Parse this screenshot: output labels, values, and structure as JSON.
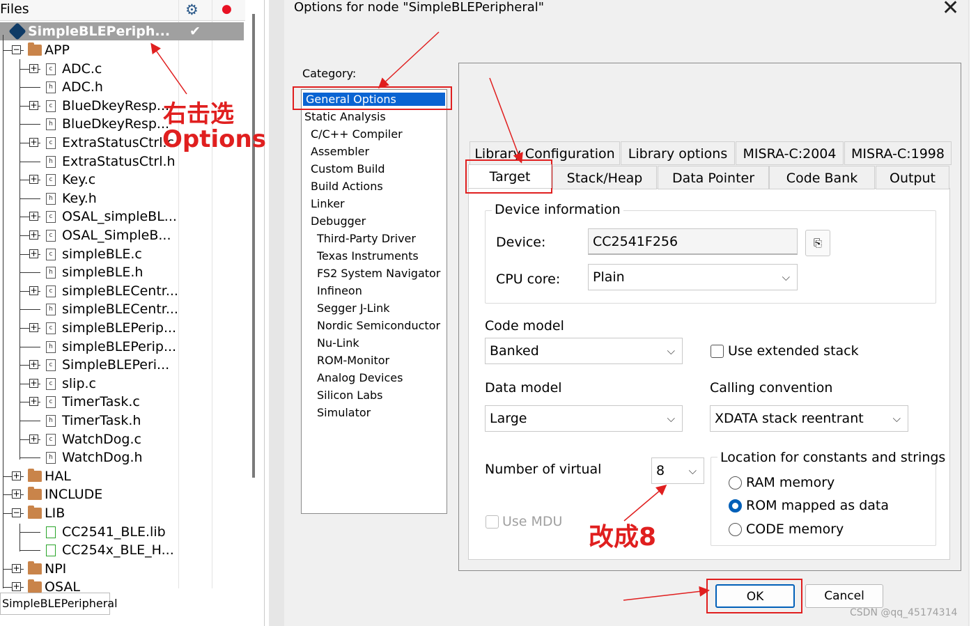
{
  "workspace": {
    "files_label": "Files",
    "project_name": "SimpleBLEPeriph...",
    "project_check": "✔",
    "bottom_tab": "SimpleBLEPeripheral",
    "tree": [
      {
        "label": "APP",
        "type": "folder",
        "level": 1,
        "pm": "−"
      },
      {
        "label": "ADC.c",
        "type": "c",
        "level": 2,
        "pm": "+"
      },
      {
        "label": "ADC.h",
        "type": "h",
        "level": 2,
        "pm": ""
      },
      {
        "label": "BlueDkeyResp...",
        "type": "c",
        "level": 2,
        "pm": "+"
      },
      {
        "label": "BlueDkeyResp...",
        "type": "h",
        "level": 2,
        "pm": ""
      },
      {
        "label": "ExtraStatusCtrl.c",
        "type": "c",
        "level": 2,
        "pm": "+"
      },
      {
        "label": "ExtraStatusCtrl.h",
        "type": "h",
        "level": 2,
        "pm": ""
      },
      {
        "label": "Key.c",
        "type": "c",
        "level": 2,
        "pm": "+"
      },
      {
        "label": "Key.h",
        "type": "h",
        "level": 2,
        "pm": ""
      },
      {
        "label": "OSAL_simpleBL...",
        "type": "c",
        "level": 2,
        "pm": "+"
      },
      {
        "label": "OSAL_SimpleB...",
        "type": "c",
        "level": 2,
        "pm": "+"
      },
      {
        "label": "simpleBLE.c",
        "type": "c",
        "level": 2,
        "pm": "+"
      },
      {
        "label": "simpleBLE.h",
        "type": "h",
        "level": 2,
        "pm": ""
      },
      {
        "label": "simpleBLECentr...",
        "type": "c",
        "level": 2,
        "pm": "+"
      },
      {
        "label": "simpleBLECentr...",
        "type": "h",
        "level": 2,
        "pm": ""
      },
      {
        "label": "simpleBLEPerip...",
        "type": "c",
        "level": 2,
        "pm": "+"
      },
      {
        "label": "simpleBLEPerip...",
        "type": "h",
        "level": 2,
        "pm": ""
      },
      {
        "label": "SimpleBLEPeri...",
        "type": "c",
        "level": 2,
        "pm": "+"
      },
      {
        "label": "slip.c",
        "type": "c",
        "level": 2,
        "pm": "+"
      },
      {
        "label": "TimerTask.c",
        "type": "c",
        "level": 2,
        "pm": "+"
      },
      {
        "label": "TimerTask.h",
        "type": "h",
        "level": 2,
        "pm": ""
      },
      {
        "label": "WatchDog.c",
        "type": "c",
        "level": 2,
        "pm": "+"
      },
      {
        "label": "WatchDog.h",
        "type": "h",
        "level": 2,
        "pm": ""
      },
      {
        "label": "HAL",
        "type": "folder",
        "level": 1,
        "pm": "+"
      },
      {
        "label": "INCLUDE",
        "type": "folder",
        "level": 1,
        "pm": "+"
      },
      {
        "label": "LIB",
        "type": "folder",
        "level": 1,
        "pm": "−"
      },
      {
        "label": "CC2541_BLE.lib",
        "type": "lib",
        "level": 2,
        "pm": ""
      },
      {
        "label": "CC254x_BLE_H...",
        "type": "lib",
        "level": 2,
        "pm": ""
      },
      {
        "label": "NPI",
        "type": "folder",
        "level": 1,
        "pm": "+"
      },
      {
        "label": "OSAL",
        "type": "folder",
        "level": 1,
        "pm": "+"
      }
    ]
  },
  "dialog": {
    "title": "Options for node \"SimpleBLEPeripheral\"",
    "close_glyph": "✕",
    "category_label": "Category:",
    "categories": [
      {
        "label": "General Options",
        "indent": 0,
        "selected": true
      },
      {
        "label": "Static Analysis",
        "indent": 0
      },
      {
        "label": "C/C++ Compiler",
        "indent": 1
      },
      {
        "label": "Assembler",
        "indent": 1
      },
      {
        "label": "Custom Build",
        "indent": 1
      },
      {
        "label": "Build Actions",
        "indent": 1
      },
      {
        "label": "Linker",
        "indent": 1
      },
      {
        "label": "Debugger",
        "indent": 1
      },
      {
        "label": "Third-Party Driver",
        "indent": 2
      },
      {
        "label": "Texas Instruments",
        "indent": 2
      },
      {
        "label": "FS2 System Navigator",
        "indent": 2
      },
      {
        "label": "Infineon",
        "indent": 2
      },
      {
        "label": "Segger J-Link",
        "indent": 2
      },
      {
        "label": "Nordic Semiconductor",
        "indent": 2
      },
      {
        "label": "Nu-Link",
        "indent": 2
      },
      {
        "label": "ROM-Monitor",
        "indent": 2
      },
      {
        "label": "Analog Devices",
        "indent": 2
      },
      {
        "label": "Silicon Labs",
        "indent": 2
      },
      {
        "label": "Simulator",
        "indent": 2
      }
    ],
    "tabs_row1": [
      "Library Configuration",
      "Library options",
      "MISRA-C:2004",
      "MISRA-C:1998"
    ],
    "tabs_row2": [
      "Target",
      "Stack/Heap",
      "Data Pointer",
      "Code Bank",
      "Output"
    ],
    "active_tab": "Target",
    "device_info": {
      "group_title": "Device information",
      "device_label": "Device:",
      "device_value": "CC2541F256",
      "cpu_label": "CPU core:",
      "cpu_value": "Plain"
    },
    "code_model": {
      "label": "Code model",
      "value": "Banked"
    },
    "use_extended_stack": {
      "label": "Use extended stack",
      "checked": false
    },
    "data_model": {
      "label": "Data model",
      "value": "Large"
    },
    "calling_convention": {
      "label": "Calling convention",
      "value": "XDATA stack reentrant"
    },
    "number_of_virtual": {
      "label": "Number of virtual",
      "value": "8"
    },
    "use_mdu": {
      "label": "Use MDU",
      "checked": false,
      "enabled": false
    },
    "location": {
      "title": "Location for constants and strings",
      "options": [
        "RAM memory",
        "ROM mapped as data",
        "CODE memory"
      ],
      "selected": "ROM mapped as data"
    },
    "ok_label": "OK",
    "cancel_label": "Cancel"
  },
  "annotations": {
    "right_click_text": "右击选",
    "options_text": "Options",
    "change_text": "改成8",
    "color": "#e01f1f"
  },
  "watermark": "CSDN @qq_45174314"
}
